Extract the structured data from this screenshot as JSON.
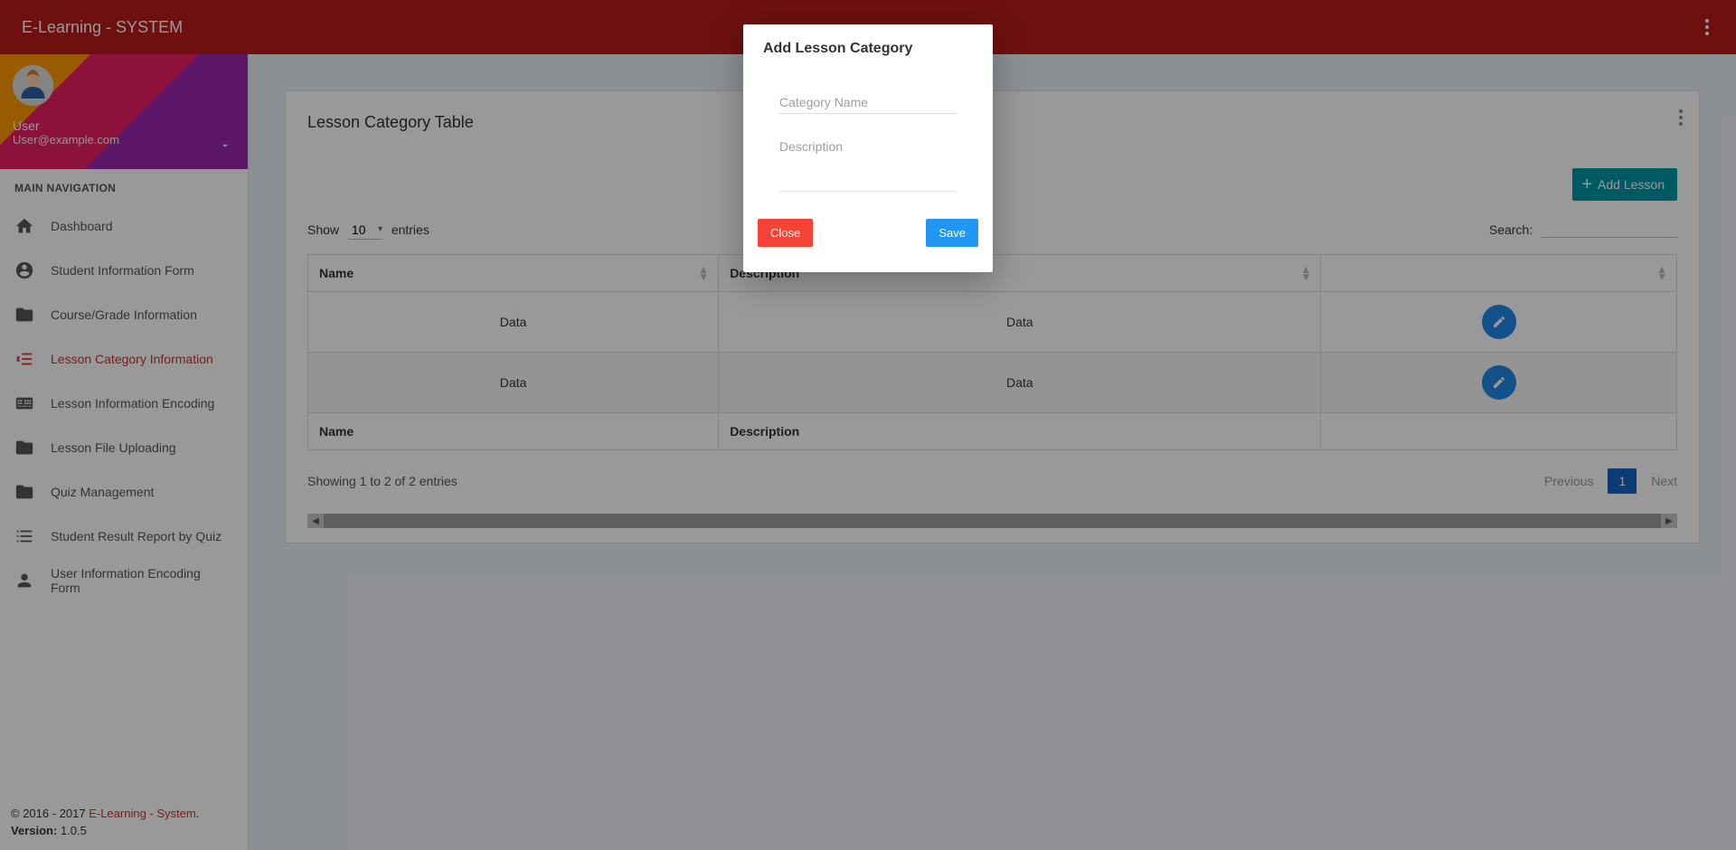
{
  "topbar": {
    "brand": "E-Learning - SYSTEM"
  },
  "user": {
    "name": "User",
    "email": "User@example.com"
  },
  "nav": {
    "header": "MAIN NAVIGATION",
    "items": [
      {
        "label": "Dashboard"
      },
      {
        "label": "Student Information Form"
      },
      {
        "label": "Course/Grade Information"
      },
      {
        "label": "Lesson Category Information"
      },
      {
        "label": "Lesson Information Encoding"
      },
      {
        "label": "Lesson File Uploading"
      },
      {
        "label": "Quiz Management"
      },
      {
        "label": "Student Result Report by Quiz"
      },
      {
        "label": "User Information Encoding Form"
      }
    ]
  },
  "footer": {
    "copyright_prefix": "© 2016 - 2017 ",
    "copyright_link": "E-Learning - System",
    "copyright_suffix": ".",
    "version_label": "Version:",
    "version_value": " 1.0.5"
  },
  "card": {
    "title": "Lesson Category Table"
  },
  "add_button": "Add Lesson",
  "table": {
    "show_label_pre": "Show",
    "show_value": "10",
    "show_label_post": "entries",
    "search_label": "Search:",
    "headers": {
      "name": "Name",
      "description": "Description",
      "action": ""
    },
    "footers": {
      "name": "Name",
      "description": "Description",
      "action": ""
    },
    "rows": [
      {
        "name": "Data",
        "description": "Data"
      },
      {
        "name": "Data",
        "description": "Data"
      }
    ],
    "info": "Showing 1 to 2 of 2 entries",
    "prev": "Previous",
    "page": "1",
    "next": "Next"
  },
  "modal": {
    "title": "Add Lesson Category",
    "field1_placeholder": "Category Name",
    "field2_placeholder": "Description",
    "close": "Close",
    "save": "Save"
  }
}
